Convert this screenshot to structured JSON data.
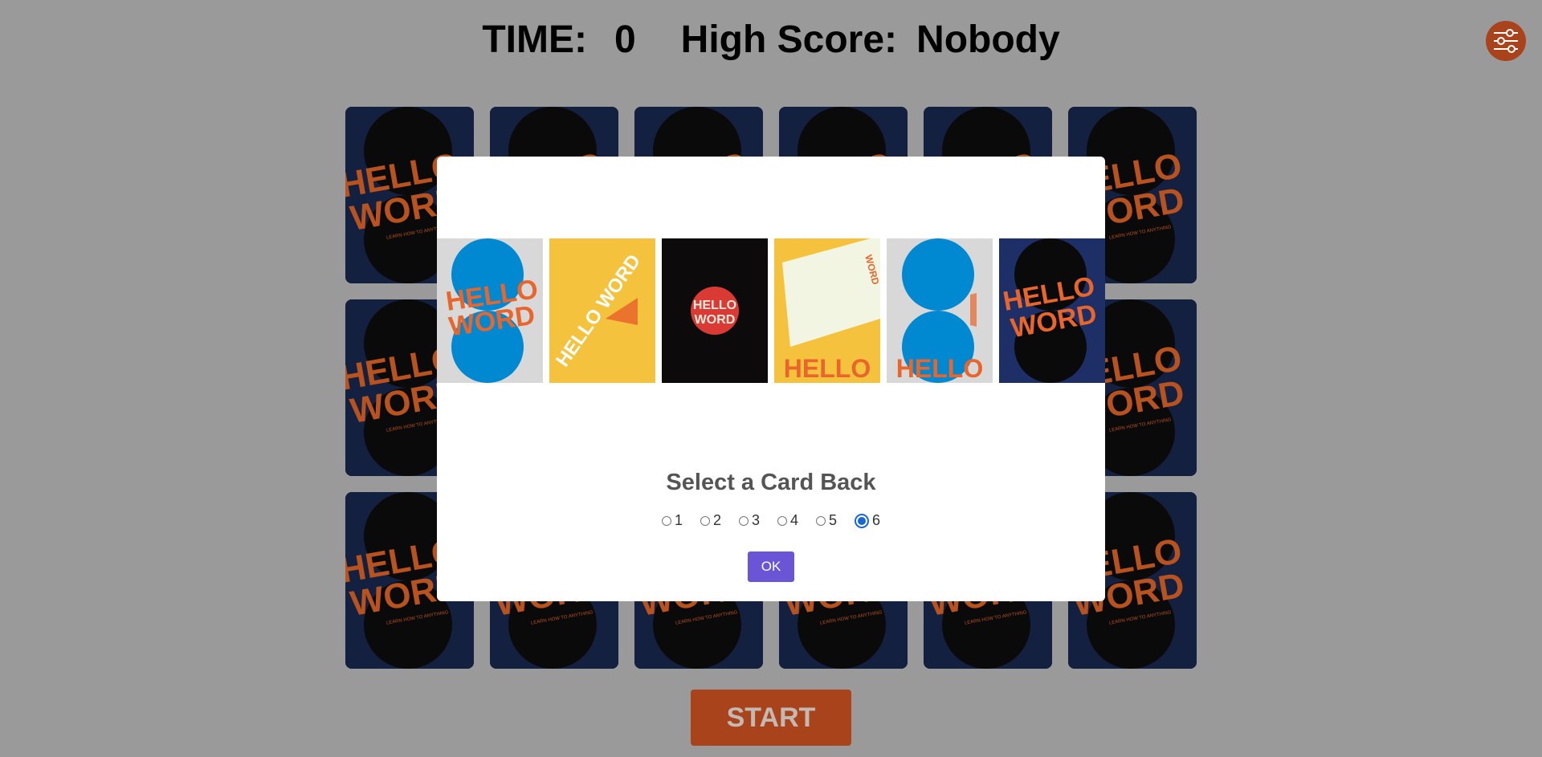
{
  "header": {
    "time_label": "TIME:",
    "time_value": "0",
    "high_score_label": "High Score:",
    "high_score_value": "Nobody"
  },
  "settings": {
    "icon": "sliders-icon",
    "color": "#a9431c"
  },
  "board": {
    "rows": 3,
    "columns": 6,
    "card_text_top": "HELLO",
    "card_text_bottom": "WORD",
    "card_tagline": "LEARN HOW TO ANYTHING"
  },
  "start_button": {
    "label": "START"
  },
  "modal": {
    "title": "Select a Card Back",
    "options": [
      "1",
      "2",
      "3",
      "4",
      "5",
      "6"
    ],
    "selected": "6",
    "ok_label": "OK",
    "backs": [
      {
        "style": "blue-circles",
        "text_top": "HELLO",
        "text_bottom": "WORD"
      },
      {
        "style": "yellow-circle-text",
        "text": "HELLO WORD"
      },
      {
        "style": "black-red-badge",
        "text_top": "HELLO",
        "text_bottom": "WORD"
      },
      {
        "style": "yellow-tilted-card",
        "text_side": "WORD",
        "text_bottom": "HELLO"
      },
      {
        "style": "grey-blue-circles",
        "text_bottom": "HELLO"
      },
      {
        "style": "navy-black-circles",
        "text_top": "HELLO",
        "text_bottom": "WORD"
      }
    ]
  },
  "colors": {
    "accent_orange": "#e8652b",
    "brand_navy": "#1e2e66",
    "ok_purple": "#6a55d6",
    "card_blue": "#0089d1",
    "card_yellow": "#f4c23c"
  }
}
